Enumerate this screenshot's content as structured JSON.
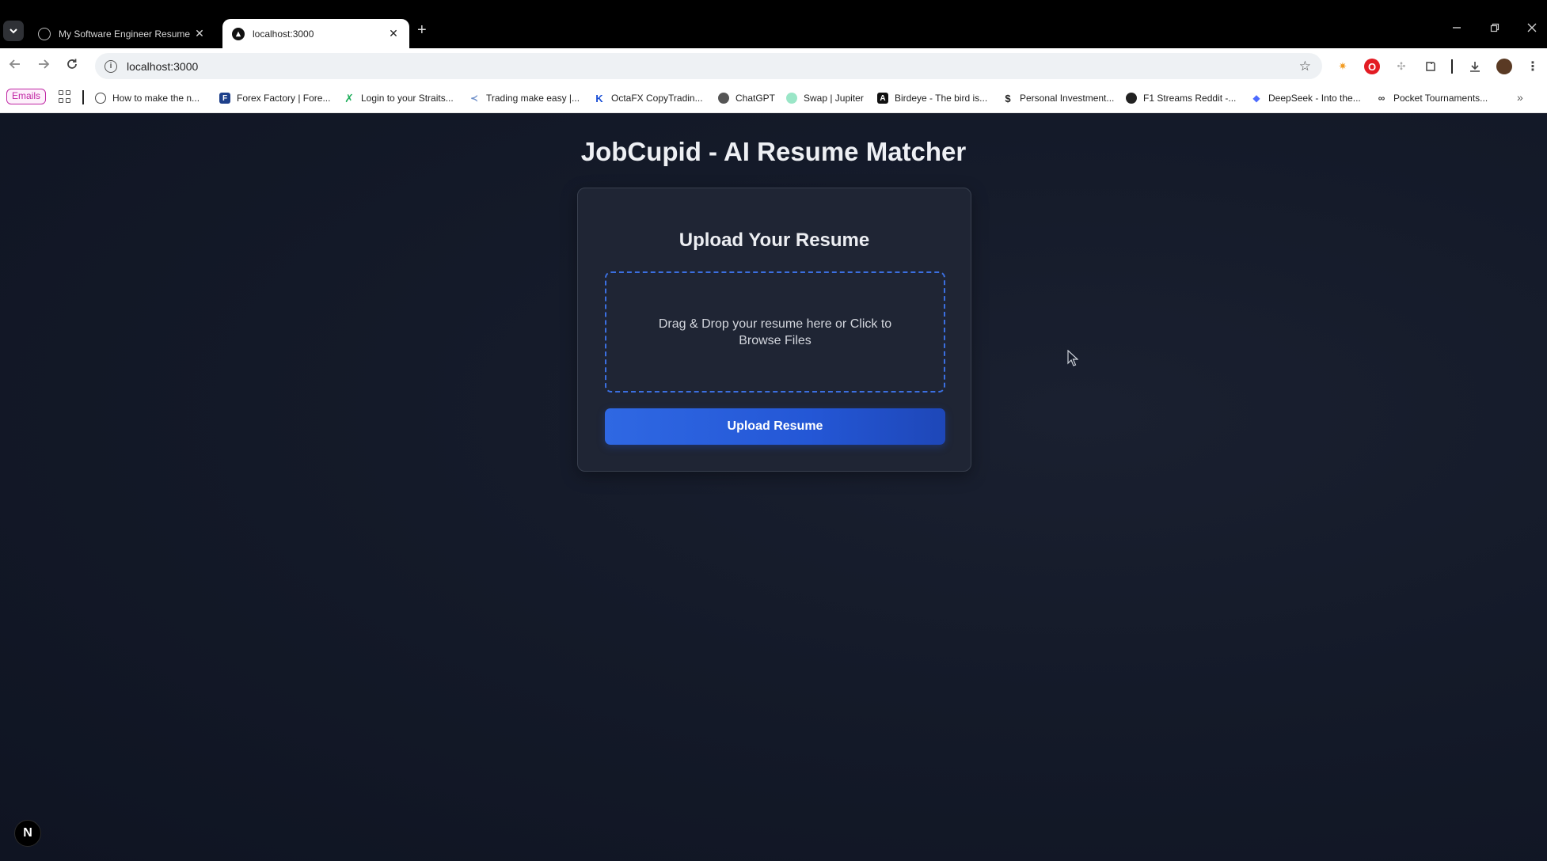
{
  "browser": {
    "tabs": [
      {
        "title": "My Software Engineer Resume",
        "active": false
      },
      {
        "title": "localhost:3000",
        "active": true
      }
    ],
    "new_tab_glyph": "+",
    "close_glyph": "✕",
    "url": "localhost:3000",
    "bookmarks": [
      {
        "label": "Emails",
        "icon": "emails-chip"
      },
      {
        "label": "How to make the n...",
        "icon": "globe-icon",
        "color": "#444444"
      },
      {
        "label": "Forex Factory | Fore...",
        "icon": "forex-factory-icon",
        "color": "#1d3f8a"
      },
      {
        "label": "Login to your Straits...",
        "icon": "straits-icon",
        "color": "#1fae5b"
      },
      {
        "label": "Trading make easy |...",
        "icon": "trading-icon",
        "color": "#6a8cc7"
      },
      {
        "label": "OctaFX CopyTradin...",
        "icon": "octafx-icon",
        "color": "#1a4fd6"
      },
      {
        "label": "ChatGPT",
        "icon": "chatgpt-icon",
        "color": "#333333"
      },
      {
        "label": "Swap | Jupiter",
        "icon": "jupiter-icon",
        "color": "#9ae6c7"
      },
      {
        "label": "Birdeye - The bird is...",
        "icon": "birdeye-icon",
        "color": "#111111"
      },
      {
        "label": "Personal Investment...",
        "icon": "dollar-icon",
        "color": "#222222"
      },
      {
        "label": "F1 Streams Reddit -...",
        "icon": "reddit-icon",
        "color": "#222222"
      },
      {
        "label": "DeepSeek - Into the...",
        "icon": "deepseek-icon",
        "color": "#4d6bfe"
      },
      {
        "label": "Pocket Tournaments...",
        "icon": "pocket-icon",
        "color": "#333333"
      }
    ]
  },
  "page": {
    "title": "JobCupid - AI Resume Matcher",
    "card_title": "Upload Your Resume",
    "dropzone_text": "Drag & Drop your resume here or Click to Browse Files",
    "upload_button": "Upload Resume",
    "badge": "N"
  },
  "colors": {
    "accent": "#2f68e3",
    "dropzone_border": "#3b6fe0",
    "background": "#141a29",
    "card": "#1f2534"
  }
}
